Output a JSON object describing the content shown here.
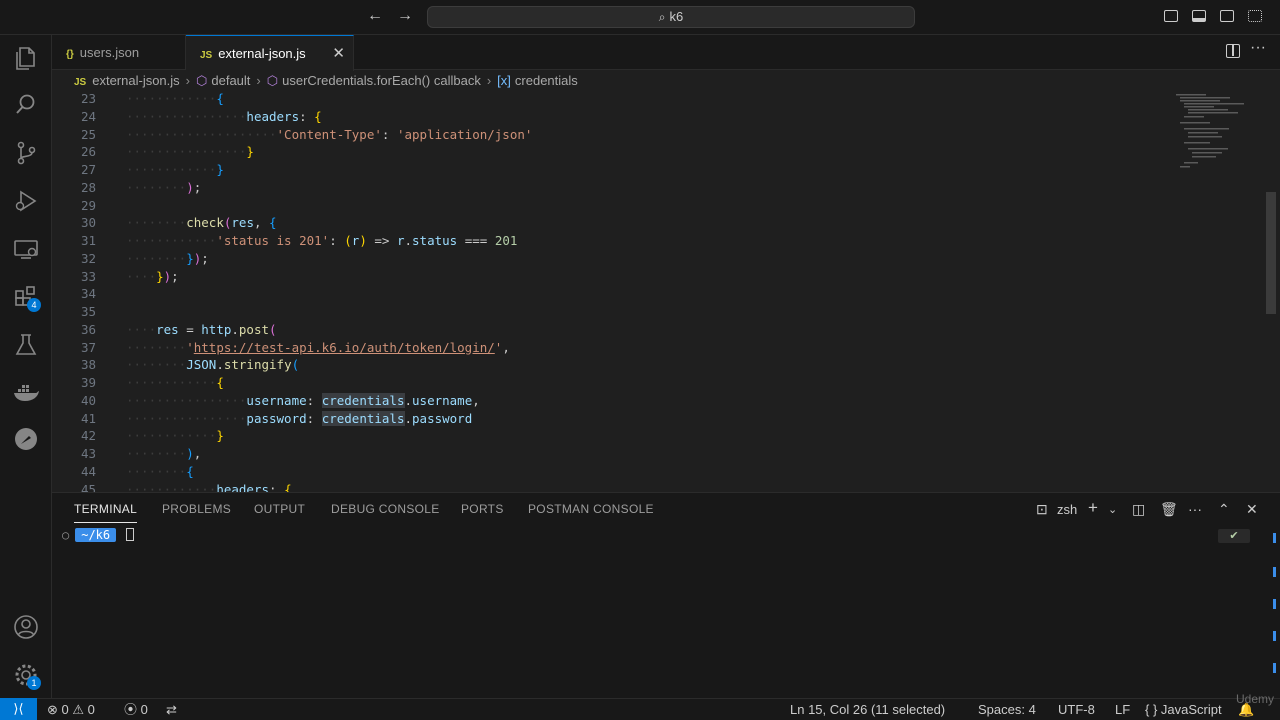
{
  "window": {
    "search_text": "k6"
  },
  "tabs": [
    {
      "label": "users.json",
      "icon": "json-file-icon",
      "icon_text": "{}"
    },
    {
      "label": "external-json.js",
      "icon": "js-file-icon",
      "icon_text": "JS",
      "close": "✕"
    }
  ],
  "breadcrumb": {
    "file": "external-json.js",
    "file_icon_text": "JS",
    "items": [
      "default",
      "userCredentials.forEach() callback",
      "credentials"
    ]
  },
  "editor": {
    "lines": [
      {
        "n": "23"
      },
      {
        "n": "24"
      },
      {
        "n": "25"
      },
      {
        "n": "26"
      },
      {
        "n": "27"
      },
      {
        "n": "28"
      },
      {
        "n": "29"
      },
      {
        "n": "30"
      },
      {
        "n": "31"
      },
      {
        "n": "32"
      },
      {
        "n": "33"
      },
      {
        "n": "34"
      },
      {
        "n": "35"
      },
      {
        "n": "36"
      },
      {
        "n": "37"
      },
      {
        "n": "38"
      },
      {
        "n": "39"
      },
      {
        "n": "40"
      },
      {
        "n": "41"
      },
      {
        "n": "42"
      },
      {
        "n": "43"
      },
      {
        "n": "44"
      },
      {
        "n": "45"
      }
    ],
    "code": {
      "l24_key": "headers",
      "l25_key": "'Content-Type'",
      "l25_val": "'application/json'",
      "l30_fn": "check",
      "l30_arg": "res",
      "l31_str": "'status is 201'",
      "l31_param": "r",
      "l31_expr_obj": "r",
      "l31_expr_prop": "status",
      "l31_num": "201",
      "l36_var": "res",
      "l36_obj": "http",
      "l36_fn": "post",
      "l37_url": "https://test-api.k6.io/auth/token/login/",
      "l38_obj": "JSON",
      "l38_fn": "stringify",
      "l40_key": "username",
      "l40_obj": "credentials",
      "l40_prop": "username",
      "l41_key": "password",
      "l41_obj": "credentials",
      "l41_prop": "password",
      "l45_key": "headers"
    }
  },
  "panel": {
    "tabs": [
      "TERMINAL",
      "PROBLEMS",
      "OUTPUT",
      "DEBUG CONSOLE",
      "PORTS",
      "POSTMAN CONSOLE"
    ],
    "active_tab": "TERMINAL",
    "shell": "zsh",
    "prompt_path": "~/k6",
    "status_mark": "✔"
  },
  "activity": {
    "extensions_badge": "4",
    "settings_badge": "1"
  },
  "statusbar": {
    "errors": "0",
    "warnings": "0",
    "ports": "0",
    "cursor": "Ln 15, Col 26 (11 selected)",
    "spaces": "Spaces: 4",
    "encoding": "UTF-8",
    "eol": "LF",
    "language": "JavaScript",
    "language_icon_text": "{ }"
  },
  "watermark": "Udemy",
  "colors": {
    "accent": "#0078d4",
    "string": "#ce9178",
    "function": "#dcdcaa",
    "variable": "#9cdcfe",
    "number": "#b5cea8"
  }
}
